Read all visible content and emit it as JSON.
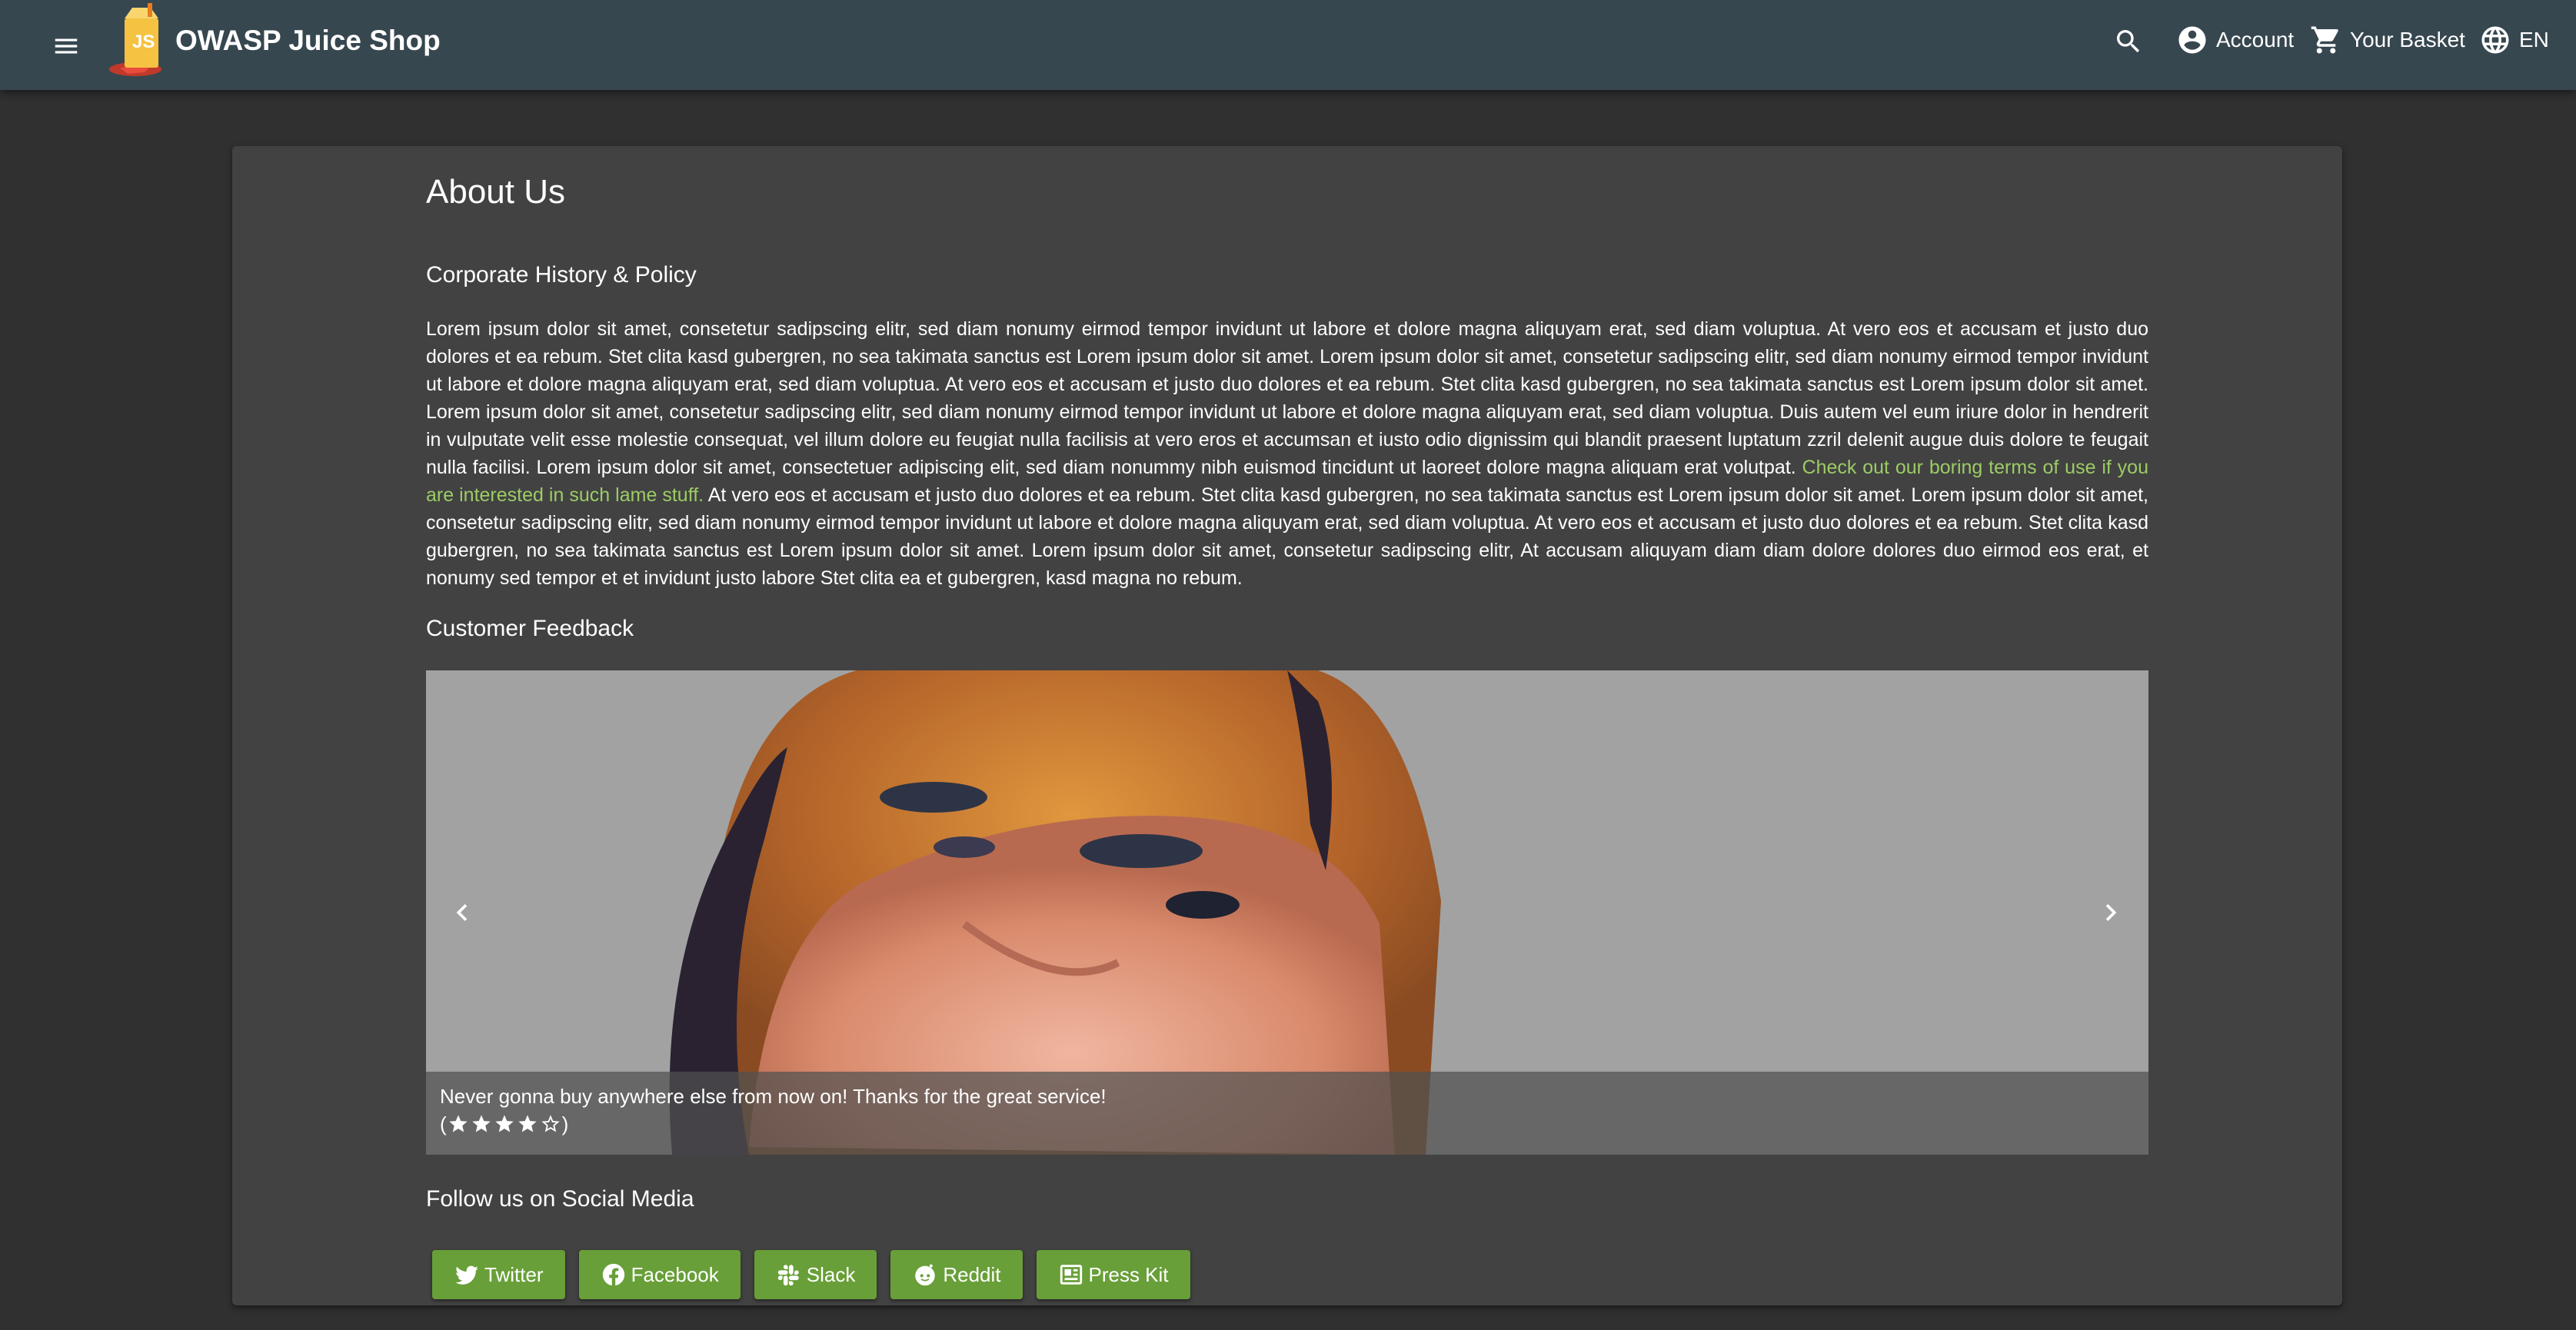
{
  "toolbar": {
    "app_title": "OWASP Juice Shop",
    "account_label": "Account",
    "basket_label": "Your Basket",
    "language_label": "EN"
  },
  "about": {
    "page_title": "About Us",
    "history_heading": "Corporate History & Policy",
    "history_text_1": "Lorem ipsum dolor sit amet, consetetur sadipscing elitr, sed diam nonumy eirmod tempor invidunt ut labore et dolore magna aliquyam erat, sed diam voluptua. At vero eos et accusam et justo duo dolores et ea rebum. Stet clita kasd gubergren, no sea takimata sanctus est Lorem ipsum dolor sit amet. Lorem ipsum dolor sit amet, consetetur sadipscing elitr, sed diam nonumy eirmod tempor invidunt ut labore et dolore magna aliquyam erat, sed diam voluptua. At vero eos et accusam et justo duo dolores et ea rebum. Stet clita kasd gubergren, no sea takimata sanctus est Lorem ipsum dolor sit amet. Lorem ipsum dolor sit amet, consetetur sadipscing elitr, sed diam nonumy eirmod tempor invidunt ut labore et dolore magna aliquyam erat, sed diam voluptua. Duis autem vel eum iriure dolor in hendrerit in vulputate velit esse molestie consequat, vel illum dolore eu feugiat nulla facilisis at vero eros et accumsan et iusto odio dignissim qui blandit praesent luptatum zzril delenit augue duis dolore te feugait nulla facilisi. Lorem ipsum dolor sit amet, consectetuer adipiscing elit, sed diam nonummy nibh euismod tincidunt ut laoreet dolore magna aliquam erat volutpat. ",
    "terms_link": "Check out our boring terms of use if you are interested in such lame stuff.",
    "history_text_2": " At vero eos et accusam et justo duo dolores et ea rebum. Stet clita kasd gubergren, no sea takimata sanctus est Lorem ipsum dolor sit amet. Lorem ipsum dolor sit amet, consetetur sadipscing elitr, sed diam nonumy eirmod tempor invidunt ut labore et dolore magna aliquyam erat, sed diam voluptua. At vero eos et accusam et justo duo dolores et ea rebum. Stet clita kasd gubergren, no sea takimata sanctus est Lorem ipsum dolor sit amet. Lorem ipsum dolor sit amet, consetetur sadipscing elitr, At accusam aliquyam diam diam dolore dolores duo eirmod eos erat, et nonumy sed tempor et et invidunt justo labore Stet clita ea et gubergren, kasd magna no rebum.",
    "feedback_heading": "Customer Feedback",
    "feedback_caption": "Never gonna buy anywhere else from now on! Thanks for the great service!",
    "rating_open": "(",
    "rating_close": ")",
    "rating_value": 4,
    "rating_max": 5,
    "social_heading": "Follow us on Social Media"
  },
  "social": {
    "twitter": "Twitter",
    "facebook": "Facebook",
    "slack": "Slack",
    "reddit": "Reddit",
    "press_kit": "Press Kit"
  },
  "colors": {
    "toolbar": "#37474f",
    "background": "#303030",
    "card": "#424242",
    "accent": "#689f38",
    "link": "#9ccc65"
  },
  "icons": {
    "menu": "menu-icon",
    "search": "search-icon",
    "account": "account-circle-icon",
    "basket": "shopping-cart-icon",
    "language": "globe-icon",
    "prev": "chevron-left-icon",
    "next": "chevron-right-icon"
  }
}
